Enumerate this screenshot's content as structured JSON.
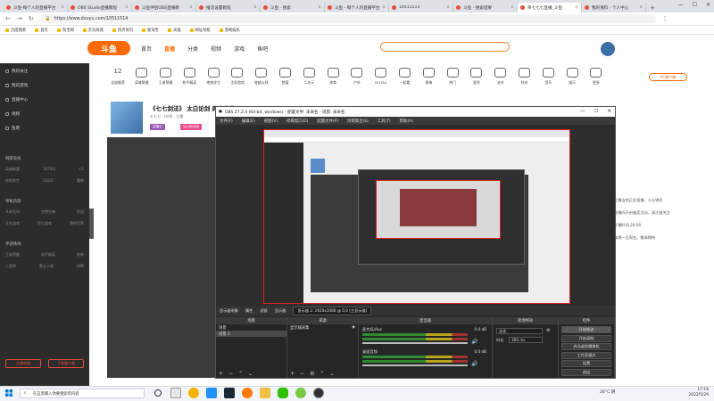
{
  "browser": {
    "tabs": [
      {
        "label": "斗鱼·每个人的直播平台",
        "active": false
      },
      {
        "label": "OBS Studio直播教程",
        "active": false
      },
      {
        "label": "斗鱼伴侣OBS直播教",
        "active": false
      },
      {
        "label": "推流设置教程",
        "active": false
      },
      {
        "label": "斗鱼 - 搜索",
        "active": false
      },
      {
        "label": "斗鱼 - 每个人的直播平台",
        "active": false
      },
      {
        "label": "10511514",
        "active": false
      },
      {
        "label": "斗鱼 - 搜索结果",
        "active": false
      },
      {
        "label": "带七七七直播_斗鱼",
        "active": true
      },
      {
        "label": "我的资料 - 个人中心",
        "active": false
      }
    ],
    "url": "https://www.douyu.com/10511514",
    "bookmarks": [
      "百度搜索",
      "首页",
      "淘宝网",
      "京东商城",
      "热点资讯",
      "爱淘宝",
      "天猫",
      "网址导航",
      "游戏娱乐"
    ]
  },
  "site": {
    "logo": "斗鱼",
    "nav": [
      "首页",
      "直播",
      "分类",
      "视频",
      "游戏",
      "鱼吧"
    ],
    "nav_active": "直播",
    "pc_badge": "PC客户端"
  },
  "categories": [
    {
      "label": "全部推荐",
      "num": "12"
    },
    {
      "label": "英雄联盟"
    },
    {
      "label": "王者荣耀"
    },
    {
      "label": "和平精英"
    },
    {
      "label": "绝地求生"
    },
    {
      "label": "主机游戏"
    },
    {
      "label": "穿越火线"
    },
    {
      "label": "颜值"
    },
    {
      "label": "二次元"
    },
    {
      "label": "体育"
    },
    {
      "label": "户外"
    },
    {
      "label": "DOTA2"
    },
    {
      "label": "一起看"
    },
    {
      "label": "原神"
    },
    {
      "label": "热门"
    },
    {
      "label": "星秀"
    },
    {
      "label": "派对"
    },
    {
      "label": "科技"
    },
    {
      "label": "音乐"
    },
    {
      "label": "娱乐"
    },
    {
      "label": "更多"
    }
  ],
  "sidebar": {
    "items": [
      "我的关注",
      "我的游戏",
      "直播中心",
      "视频",
      "鱼吧"
    ],
    "groups": [
      "网游竞技",
      "单机热游",
      "手游休闲"
    ],
    "sub_rows": [
      [
        "英雄联盟",
        "DOTA2",
        "CF"
      ],
      [
        "绝地求生",
        "CSGO",
        "魔兽"
      ],
      [
        "永劫无间",
        "守望先锋",
        "逆战"
      ],
      [
        "主机游戏",
        "怀旧游戏",
        "我的世界"
      ],
      [
        "王者荣耀",
        "和平精英",
        "原神"
      ],
      [
        "三国杀",
        "第五人格",
        "棋牌"
      ]
    ],
    "btn_left": "开播申请",
    "btn_right": "下载客户端"
  },
  "room": {
    "title": "《七七剑法》 太白论剑 周末不休",
    "meta": "七七七  ·  LV48  ·  主播",
    "tag1": "直播中",
    "tag2": "加入粉丝团",
    "side_text": [
      "主播当前正在直播，十分钟后",
      "直播间开启抽奖活动，请注意关注",
      "开播时间 20:00",
      "每周一至周五，敬请期待"
    ]
  },
  "obs": {
    "title": "OBS 27.2.4 (64-bit, windows) - 配置文件: 未命名 - 场景: 未命名",
    "menu": [
      "文件(F)",
      "编辑(E)",
      "视图(V)",
      "停靠窗口(D)",
      "配置文件(P)",
      "场景集合(S)",
      "工具(T)",
      "帮助(H)"
    ],
    "source_bar": [
      "显示器采集",
      "属性",
      "滤镜",
      "显示器",
      "显示器 2: 1920x1080 @ 0,0 (主显示器)"
    ],
    "docks": {
      "scenes": {
        "header": "场景",
        "items": [
          "场景",
          "场景 2"
        ],
        "selected": 1
      },
      "sources": {
        "header": "来源",
        "items": [
          "显示器采集"
        ]
      },
      "mixer": {
        "header": "混音器",
        "tracks": [
          {
            "name": "麦克风/Aux",
            "db": "0.0 dB"
          },
          {
            "name": "桌面音频",
            "db": "0.0 dB"
          }
        ]
      },
      "transitions": {
        "header": "转场特效",
        "type": "淡化",
        "duration_label": "时长",
        "duration": "300 ms"
      },
      "controls": {
        "header": "控件",
        "buttons": [
          "开始推流",
          "开始录制",
          "启动虚拟摄像机",
          "工作室模式",
          "设置",
          "退出"
        ],
        "active_index": 0
      }
    },
    "status": {
      "live": "LIVE: 00:00:00",
      "rec": "REC: 00:00:00",
      "cpu": "CPU: 1.4%, 30.00 fps"
    }
  },
  "taskbar": {
    "search_placeholder": "在这里输入你要搜索的内容",
    "weather": "26°C 阴",
    "time": "17:18",
    "date": "2022/5/29"
  }
}
